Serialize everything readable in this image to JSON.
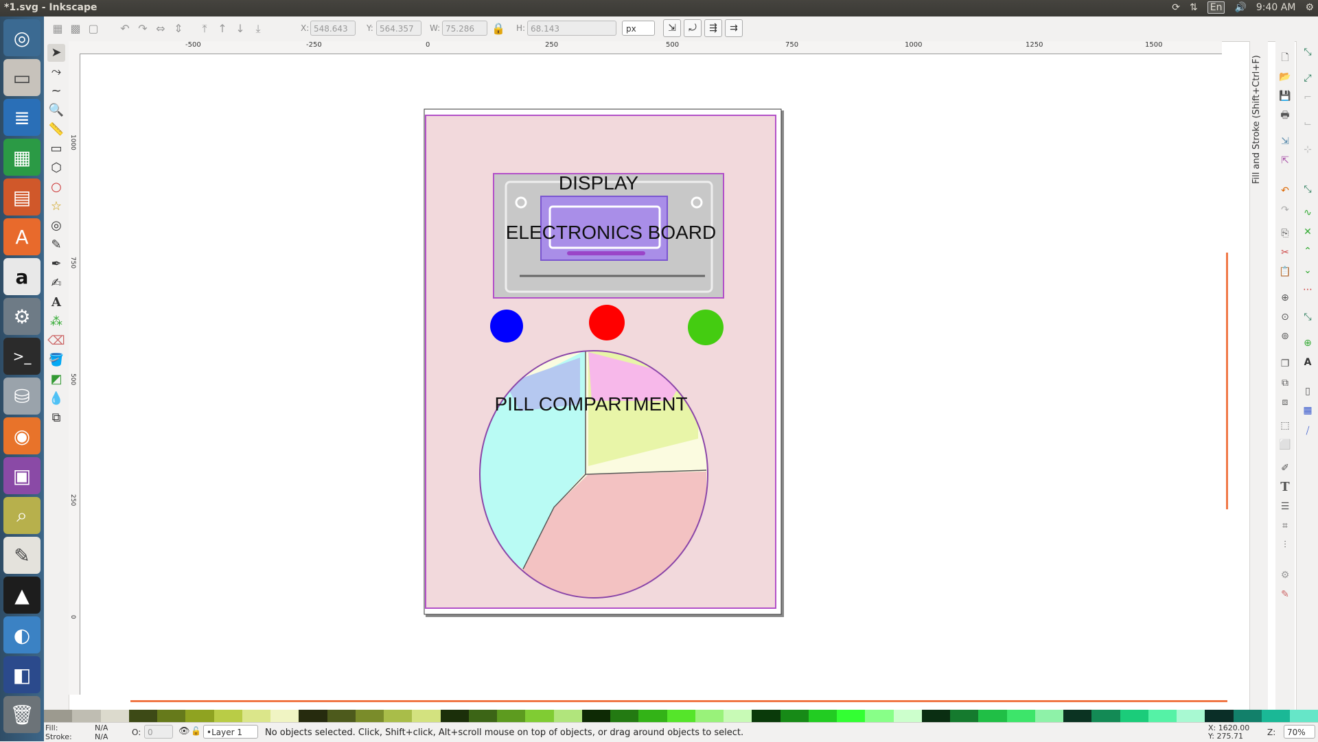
{
  "window": {
    "title": "*1.svg - Inkscape"
  },
  "systray": {
    "lang": "En",
    "time": "9:40 AM"
  },
  "toolctrl": {
    "x_label": "X:",
    "x_value": "548.643",
    "y_label": "Y:",
    "y_value": "564.357",
    "w_label": "W:",
    "w_value": "75.286",
    "h_label": "H:",
    "h_value": "68.143",
    "unit": "px"
  },
  "ruler": {
    "h_ticks": [
      "-500",
      "-250",
      "0",
      "250",
      "500",
      "750",
      "1000",
      "1250",
      "1500"
    ],
    "v_ticks": [
      "1000",
      "750",
      "500",
      "250",
      "0"
    ]
  },
  "dock": {
    "fill_stroke_title": "Fill and Stroke (Shift+Ctrl+F)"
  },
  "drawing": {
    "display_label": "DISPLAY",
    "electronics_label": "ELECTRONICS BOARD",
    "pill_label": "PILL COMPARTMENT",
    "colors": {
      "page_bg": "#f2d9dc",
      "frame": "#b24fc8",
      "board": "#c8c8c8",
      "chip": "#a98ee8",
      "blue": "#0000ff",
      "red": "#ff0000",
      "green": "#44cc11"
    }
  },
  "status": {
    "fill_label": "Fill:",
    "fill_value": "N/A",
    "stroke_label": "Stroke:",
    "stroke_value": "N/A",
    "opacity_label": "O:",
    "opacity_value": "0",
    "layer": "•Layer 1",
    "message": "No objects selected. Click, Shift+click, Alt+scroll mouse on top of objects, or drag around objects to select.",
    "cursor_x": "X: 1620.00",
    "cursor_y": "Y:  275.71",
    "zoom_label": "Z:",
    "zoom_value": "70%"
  }
}
